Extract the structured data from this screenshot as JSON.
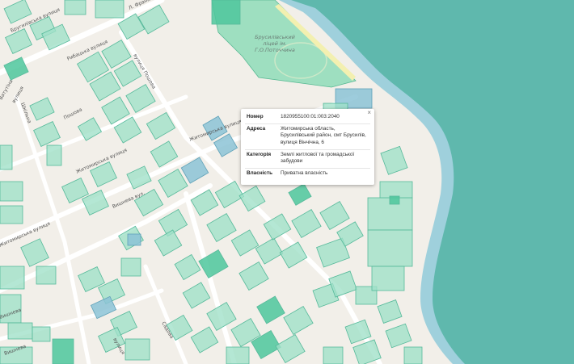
{
  "map": {
    "colors": {
      "land": "#f2efe9",
      "water": "#5fb8ad",
      "shore": "#9fd0dc",
      "parcel": "#9fe0c8",
      "park": "#8fdcb8"
    },
    "street_labels": [
      "Бругилівська вулиця",
      "Ватутіна",
      "Рибацька вулиця",
      "вулиця",
      "Л. Франка",
      "Шкільна",
      "вулиця Пошова",
      "Пошова",
      "Житомирська вулиця",
      "Житомирська вулиця",
      "Житомирська вулиця",
      "Вишнева вул.",
      "Вишнева",
      "Садова",
      "вулиця",
      "Вишнева"
    ],
    "poi_label": [
      "Брусилівський",
      "ліцей ім.",
      "Г.О.Поточчина"
    ]
  },
  "popup": {
    "close_glyph": "×",
    "rows": [
      {
        "key": "Номер",
        "value": "1820955100:01:003:2040"
      },
      {
        "key": "Адреса",
        "value": "Житомирська область, Брусилівський район, смт Брусилів, вулиця Вінчічна, 6"
      },
      {
        "key": "Категорія",
        "value": "Землі житлової та громадської забудови"
      },
      {
        "key": "Власність",
        "value": "Приватна власність"
      }
    ]
  }
}
